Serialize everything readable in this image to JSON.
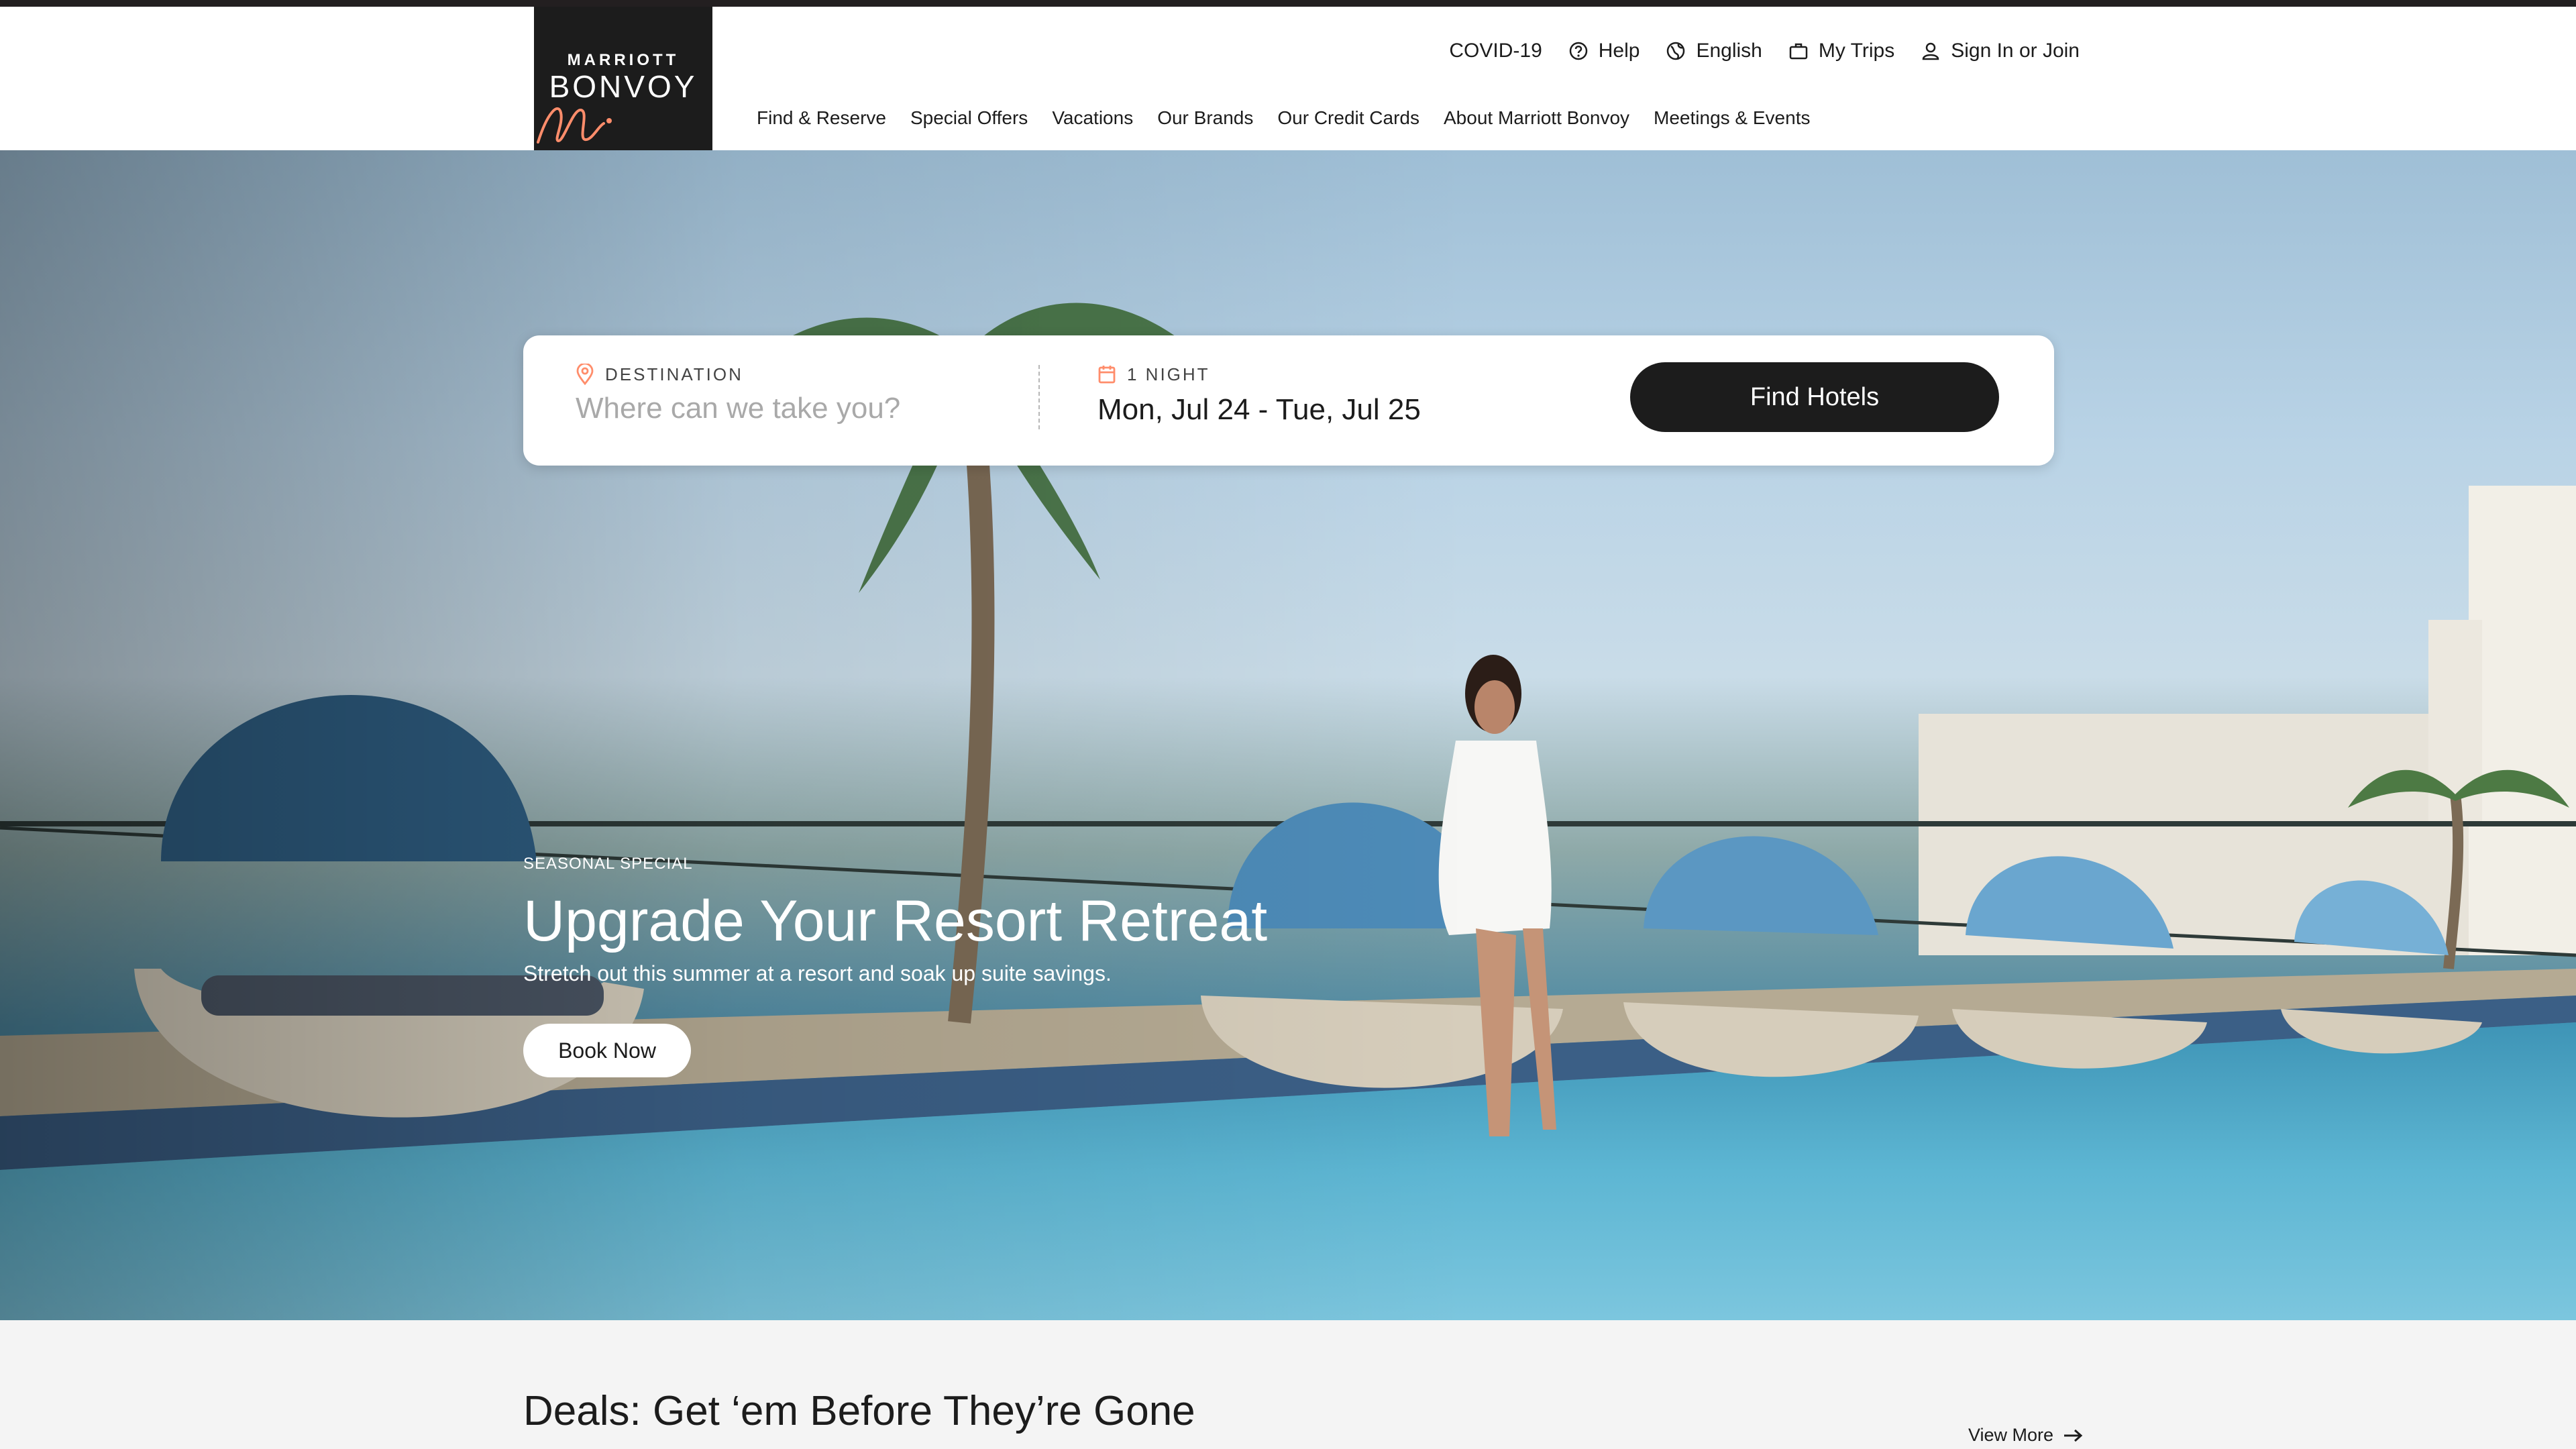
{
  "logo": {
    "line1": "MARRIOTT",
    "line2": "BONVOY"
  },
  "utility_nav": {
    "covid": "COVID-19",
    "help": "Help",
    "language": "English",
    "trips": "My Trips",
    "signin": "Sign In or Join"
  },
  "main_nav": [
    "Find & Reserve",
    "Special Offers",
    "Vacations",
    "Our Brands",
    "Our Credit Cards",
    "About Marriott Bonvoy",
    "Meetings & Events"
  ],
  "search": {
    "destination_label": "DESTINATION",
    "destination_placeholder": "Where can we take you?",
    "dates_label": "1 NIGHT",
    "dates_value": "Mon, Jul 24 - Tue, Jul 25",
    "find_button": "Find Hotels"
  },
  "hero": {
    "eyebrow": "SEASONAL SPECIAL",
    "title": "Upgrade Your Resort Retreat",
    "subtitle": "Stretch out this summer at a resort and soak up suite savings.",
    "cta": "Book Now"
  },
  "deals": {
    "title": "Deals: Get ‘em Before They’re Gone",
    "view_more": "View More"
  },
  "colors": {
    "brand_dark": "#1c1c1c",
    "accent_orange": "#ff8d6b",
    "background": "#f4f4f4"
  }
}
